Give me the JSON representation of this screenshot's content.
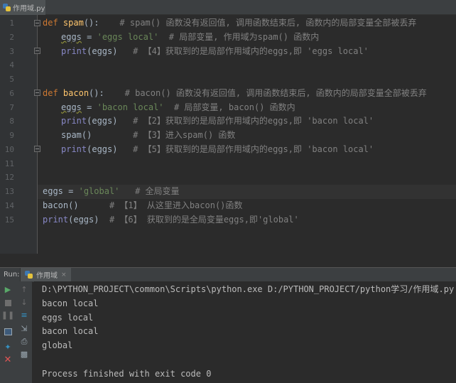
{
  "editor": {
    "file_tab": "作用域.py",
    "line_numbers": [
      "1",
      "2",
      "3",
      "4",
      "5",
      "6",
      "7",
      "8",
      "9",
      "10",
      "11",
      "12",
      "13",
      "14",
      "15"
    ],
    "line1": {
      "kw": "def",
      "fn": "spam",
      "paren": "():",
      "comment": "# spam() 函数没有返回值, 调用函数结束后, 函数内的局部变量全部被丢弃"
    },
    "line2": {
      "var": "eggs",
      "eq": " = ",
      "str": "'eggs local'",
      "comment": "# 局部变量, 作用域为spam() 函数内"
    },
    "line3": {
      "bi": "print",
      "args": "(eggs)",
      "comment": "# 【4】获取到的是局部作用域内的eggs,即 'eggs local'"
    },
    "line6": {
      "kw": "def",
      "fn": "bacon",
      "paren": "():",
      "comment": "# bacon() 函数没有返回值, 调用函数结束后, 函数内的局部变量全部被丢弃"
    },
    "line7": {
      "var": "eggs",
      "eq": " = ",
      "str": "'bacon local'",
      "comment": "# 局部变量, bacon() 函数内"
    },
    "line8": {
      "bi": "print",
      "args": "(eggs)",
      "comment": "# 【2】获取到的是局部作用域内的eggs,即 'bacon local'"
    },
    "line9": {
      "call": "spam()",
      "comment": "# 【3】进入spam() 函数"
    },
    "line10": {
      "bi": "print",
      "args": "(eggs)",
      "comment": "# 【5】获取到的是局部作用域内的eggs,即 'bacon local'"
    },
    "line13": {
      "var": "eggs",
      "eq": " = ",
      "str": "'global'",
      "comment": "# 全局变量"
    },
    "line14": {
      "call": "bacon()",
      "comment": "# 【1】 从这里进入bacon()函数"
    },
    "line15": {
      "bi": "print",
      "args": "(eggs)",
      "comment": "# 【6】 获取到的是全局变量eggs,即'global'"
    }
  },
  "run": {
    "label": "Run:",
    "tab_name": "作用域",
    "close_glyph": "×",
    "console_lines": [
      "D:\\PYTHON_PROJECT\\common\\Scripts\\python.exe D:/PYTHON_PROJECT/python学习/作用域.py",
      "bacon local",
      "eggs local",
      "bacon local",
      "global",
      "",
      "Process finished with exit code 0"
    ]
  },
  "toolbar_icons": [
    "run-icon",
    "stop-icon",
    "pause-icon",
    "scroll-up-icon",
    "scroll-down-icon",
    "dump-threads-icon",
    "soft-wrap-icon",
    "print-icon",
    "pin-icon",
    "trash-icon",
    "close-icon"
  ],
  "colors": {
    "keyword": "#cc7832",
    "function": "#ffc66d",
    "string": "#6a8759",
    "comment": "#808080",
    "builtin": "#8888c6",
    "background": "#2b2b2b"
  }
}
